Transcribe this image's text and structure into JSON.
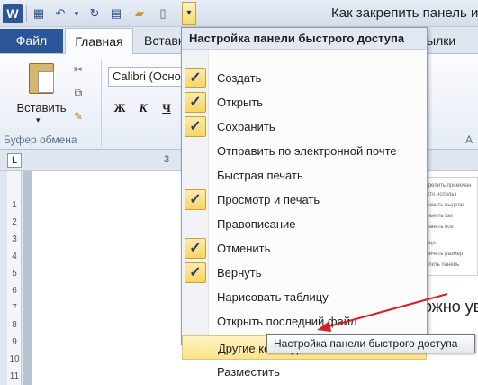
{
  "window": {
    "title": "Как закрепить панель и"
  },
  "quick_access": {
    "app_logo": "W",
    "icons": [
      "save-icon",
      "undo-icon",
      "dropdown-icon",
      "redo-icon",
      "print-preview-icon",
      "open-folder-icon",
      "new-document-icon",
      "customize-icon"
    ],
    "customize_glyph": "▾"
  },
  "tabs": {
    "file": "Файл",
    "home": "Главная",
    "insert": "Вставка",
    "right_partial": "ылки"
  },
  "ribbon": {
    "paste_label": "Вставить",
    "paste_caret": "▾",
    "clipboard_group": "Буфер обмена",
    "font_name": "Calibri (Осно",
    "bold": "Ж",
    "italic": "К",
    "underline": "Ч",
    "right_group_label": "А"
  },
  "ruler": {
    "left_numbers": [
      "1",
      "2",
      "3",
      "4",
      "5",
      "6",
      "7",
      "8",
      "9",
      "10",
      "11"
    ],
    "top_num": "3"
  },
  "document": {
    "text_fragment": "ожно ув",
    "thumbnail_lines": [
      "закрепить примечан",
      "Часто использ",
      "охранить выделе",
      "охранить как",
      "охранить все",
      "блица",
      "величить размер",
      "крепить панель"
    ]
  },
  "menu": {
    "header": "Настройка панели быстрого доступа",
    "items": [
      {
        "label": "Создать",
        "checked": true
      },
      {
        "label": "Открыть",
        "checked": true
      },
      {
        "label": "Сохранить",
        "checked": true
      },
      {
        "label": "Отправить по электронной почте",
        "checked": false
      },
      {
        "label": "Быстрая печать",
        "checked": false
      },
      {
        "label": "Просмотр и печать",
        "checked": true
      },
      {
        "label": "Правописание",
        "checked": false
      },
      {
        "label": "Отменить",
        "checked": true
      },
      {
        "label": "Вернуть",
        "checked": true
      },
      {
        "label": "Нарисовать таблицу",
        "checked": false
      },
      {
        "label": "Открыть последний файл",
        "checked": false
      },
      {
        "label": "Другие команды...",
        "checked": false,
        "highlighted": true
      },
      {
        "label": "Разместить",
        "checked": false
      }
    ],
    "check_glyph": "✓"
  },
  "tooltip": {
    "text": "Настройка панели быстрого доступа"
  },
  "colors": {
    "accent": "#2a5699",
    "highlight": "#fbe38d",
    "arrow": "#d81e1e"
  }
}
